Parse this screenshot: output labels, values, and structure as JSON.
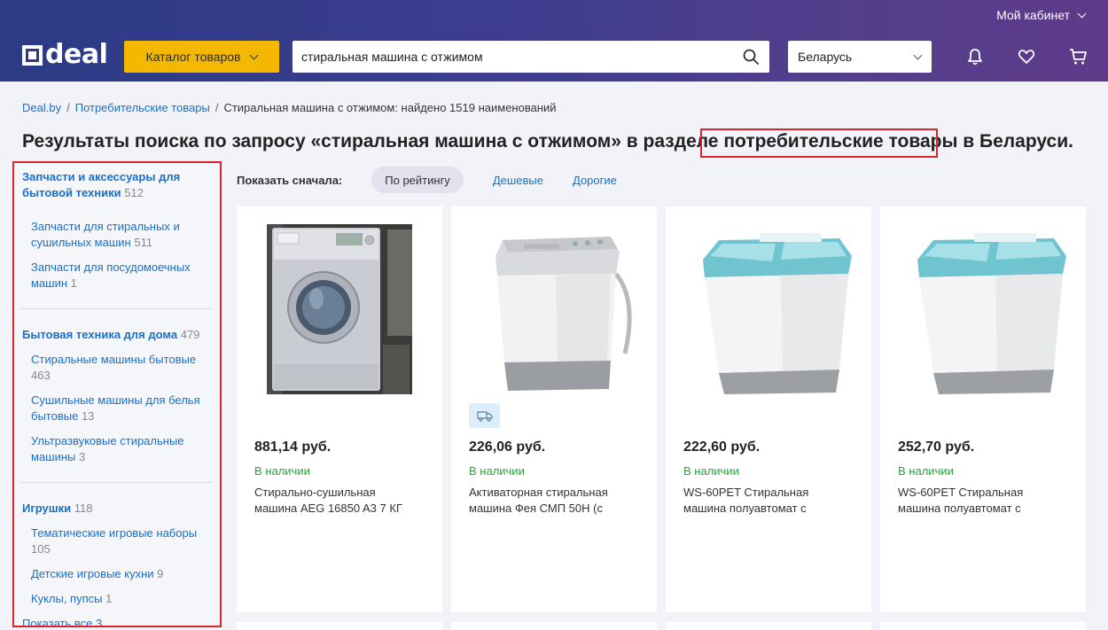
{
  "header": {
    "cabinet": "Мой кабинет",
    "logo": "deal",
    "catalog_label": "Каталог товаров",
    "search_value": "стиральная машина с отжимом",
    "region": "Беларусь",
    "icons": [
      "bell-icon",
      "heart-icon",
      "cart-icon"
    ]
  },
  "breadcrumb": {
    "home": "Deal.by",
    "sep": "/",
    "category": "Потребительские товары",
    "current": "Стиральная машина с отжимом: найдено 1519 наименований"
  },
  "title": "Результаты поиска по запросу «стиральная машина с отжимом» в разделе потребительские товары в Беларуси.",
  "sidebar": {
    "groups": [
      {
        "title": "Запчасти и аксессуары для бытовой техники",
        "count": "512",
        "items": [
          {
            "label": "Запчасти для стиральных и сушильных машин",
            "count": "511"
          },
          {
            "label": "Запчасти для посудомоечных машин",
            "count": "1"
          }
        ]
      },
      {
        "title": "Бытовая техника для дома",
        "count": "479",
        "items": [
          {
            "label": "Стиральные машины бытовые",
            "count": "463"
          },
          {
            "label": "Сушильные машины для белья бытовые",
            "count": "13"
          },
          {
            "label": "Ультразвуковые стиральные машины",
            "count": "3"
          }
        ]
      },
      {
        "title": "Игрушки",
        "count": "118",
        "items": [
          {
            "label": "Тематические игровые наборы",
            "count": "105"
          },
          {
            "label": "Детские игровые кухни",
            "count": "9"
          },
          {
            "label": "Куклы, пупсы",
            "count": "1"
          }
        ]
      }
    ],
    "show_all": "Показать все 3"
  },
  "sort": {
    "label": "Показать сначала:",
    "options": [
      "По рейтингу",
      "Дешевые",
      "Дорогие"
    ],
    "active": "По рейтингу"
  },
  "products": [
    {
      "price": "881,14 руб.",
      "stock": "В наличии",
      "name": "Стирально-сушильная машина AEG 16850 A3 7 КГ",
      "image": "front-load-washer",
      "delivery": false
    },
    {
      "price": "226,06 руб.",
      "stock": "В наличии",
      "name": "Активаторная стиральная машина Фея СМП 50Н (с",
      "image": "twin-tub-washer-grey",
      "delivery": true
    },
    {
      "price": "222,60 руб.",
      "stock": "В наличии",
      "name": "WS-60PET Стиральная машина полуавтомат с",
      "image": "twin-tub-washer-teal",
      "delivery": false
    },
    {
      "price": "252,70 руб.",
      "stock": "В наличии",
      "name": "WS-60PET Стиральная машина полуавтомат с",
      "image": "twin-tub-washer-teal",
      "delivery": false
    }
  ],
  "colors": {
    "header_start": "#2b3b84",
    "header_end": "#5e3b8a",
    "catalog_button": "#f5b800",
    "link": "#1a6fc9",
    "in_stock": "#2aa33e",
    "highlight_box": "#d9232e"
  }
}
